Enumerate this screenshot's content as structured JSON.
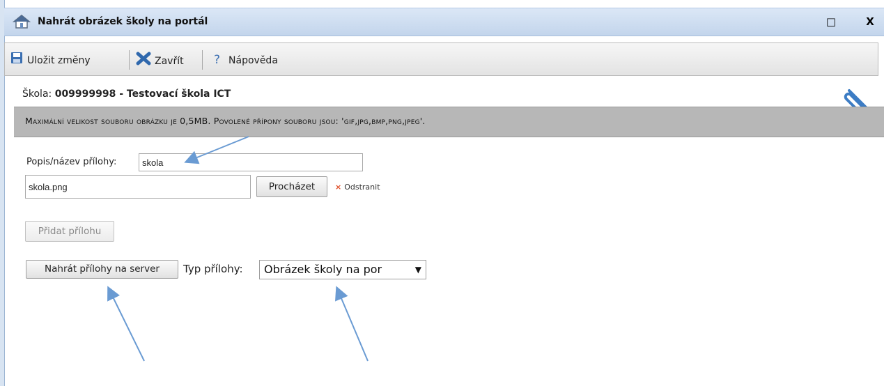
{
  "window": {
    "title": "Nahrát obrázek školy na portál",
    "maximize_glyph": "□",
    "close_glyph": "X"
  },
  "toolbar": {
    "save_label": "Uložit změny",
    "close_label": "Zavřít",
    "help_label": "Nápověda",
    "help_glyph": "?"
  },
  "school": {
    "label": "Škola:",
    "value": "009999998 - Testovací škola ICT"
  },
  "banner": {
    "text": "Maximální velikost souboru obrázku je 0,5MB. Povolené přípony souboru jsou: 'gif,jpg,bmp,png,jpeg'."
  },
  "form": {
    "description_label": "Popis/název přílohy:",
    "description_value": "skola",
    "file_value": "skola.png",
    "browse_label": "Procházet",
    "remove_label": "Odstranit",
    "remove_glyph": "×",
    "add_attachment_label": "Přidat přílohu",
    "upload_label": "Nahrát přílohy na server",
    "type_label": "Typ přílohy:",
    "type_selected": "Obrázek školy na por",
    "type_arrow": "▼"
  },
  "colors": {
    "titlebar": "#c3d5ec",
    "banner": "#b7b7b7",
    "annotation_arrow": "#6a9bd3",
    "remove_x": "#e0502a"
  },
  "icons": [
    "home-icon",
    "save-icon",
    "close-x-icon",
    "help-icon",
    "paperclip-icon"
  ]
}
